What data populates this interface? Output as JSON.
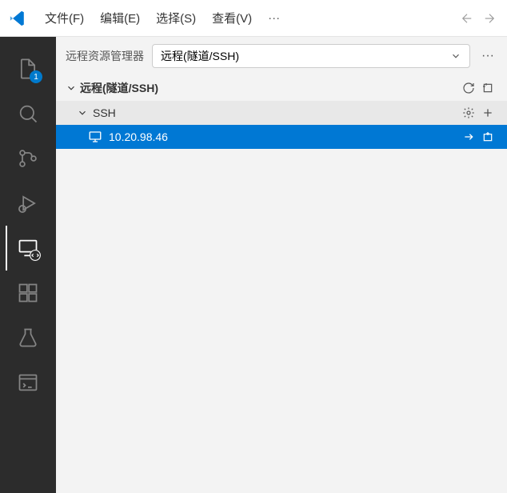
{
  "menubar": {
    "items": [
      "文件(F)",
      "编辑(E)",
      "选择(S)",
      "查看(V)"
    ],
    "more": "···"
  },
  "sidebar": {
    "title": "远程资源管理器",
    "dropdown": "远程(隧道/SSH)",
    "more": "···",
    "section": "远程(隧道/SSH)",
    "group": "SSH",
    "host": "10.20.98.46"
  },
  "activity": {
    "explorer_badge": "1"
  }
}
